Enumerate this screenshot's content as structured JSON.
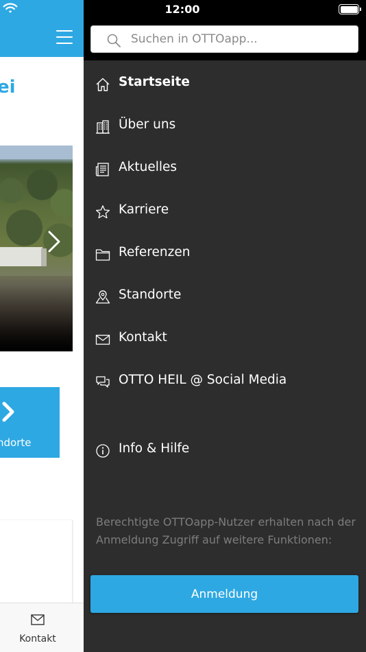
{
  "status_bar": {
    "time": "12:00"
  },
  "background_page": {
    "title_fragment": "ei",
    "tile_label": "ndorte",
    "tabbar": {
      "kontakt_label": "Kontakt"
    }
  },
  "menu": {
    "search": {
      "placeholder": "Suchen in OTTOapp..."
    },
    "items": [
      {
        "label": "Startseite",
        "icon": "home-icon",
        "active": true
      },
      {
        "label": "Über uns",
        "icon": "building-icon"
      },
      {
        "label": "Aktuelles",
        "icon": "newspaper-icon"
      },
      {
        "label": "Karriere",
        "icon": "star-icon"
      },
      {
        "label": "Referenzen",
        "icon": "folder-icon"
      },
      {
        "label": "Standorte",
        "icon": "map-pin-icon"
      },
      {
        "label": "Kontakt",
        "icon": "envelope-icon"
      },
      {
        "label": "OTTO HEIL @ Social Media",
        "icon": "chat-bubbles-icon"
      },
      {
        "label": "Info & Hilfe",
        "icon": "info-icon"
      }
    ],
    "info_text": "Berechtigte OTTOapp-Nutzer erhalten nach der Anmeldung Zugriff auf weitere Funktionen:",
    "login_label": "Anmeldung"
  },
  "colors": {
    "accent": "#2ea8e2",
    "menu_bg": "#2d2d2d",
    "header_bg": "#000000",
    "muted_text": "#7d7d7d"
  }
}
